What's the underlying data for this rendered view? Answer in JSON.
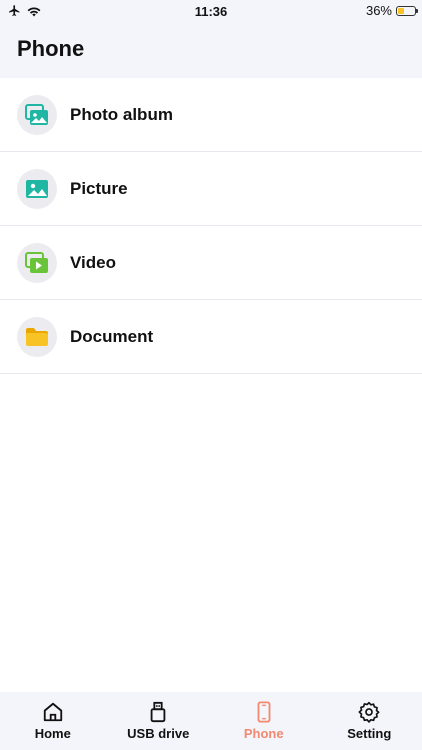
{
  "status_bar": {
    "time": "11:36",
    "battery_percent": "36%",
    "battery_level": 0.36
  },
  "header": {
    "title": "Phone"
  },
  "list": {
    "items": [
      {
        "label": "Photo album",
        "icon": "photo-album-icon"
      },
      {
        "label": "Picture",
        "icon": "picture-icon"
      },
      {
        "label": "Video",
        "icon": "video-icon"
      },
      {
        "label": "Document",
        "icon": "folder-icon"
      }
    ]
  },
  "tab_bar": {
    "tabs": [
      {
        "label": "Home",
        "icon": "home-icon"
      },
      {
        "label": "USB drive",
        "icon": "usb-icon"
      },
      {
        "label": "Phone",
        "icon": "phone-icon",
        "active": true
      },
      {
        "label": "Setting",
        "icon": "gear-icon"
      }
    ]
  },
  "colors": {
    "accent": "#f08a70",
    "teal": "#1fb7a3",
    "green": "#6ac43a",
    "yellow": "#f7c325",
    "header_bg": "#f4f4fb"
  }
}
